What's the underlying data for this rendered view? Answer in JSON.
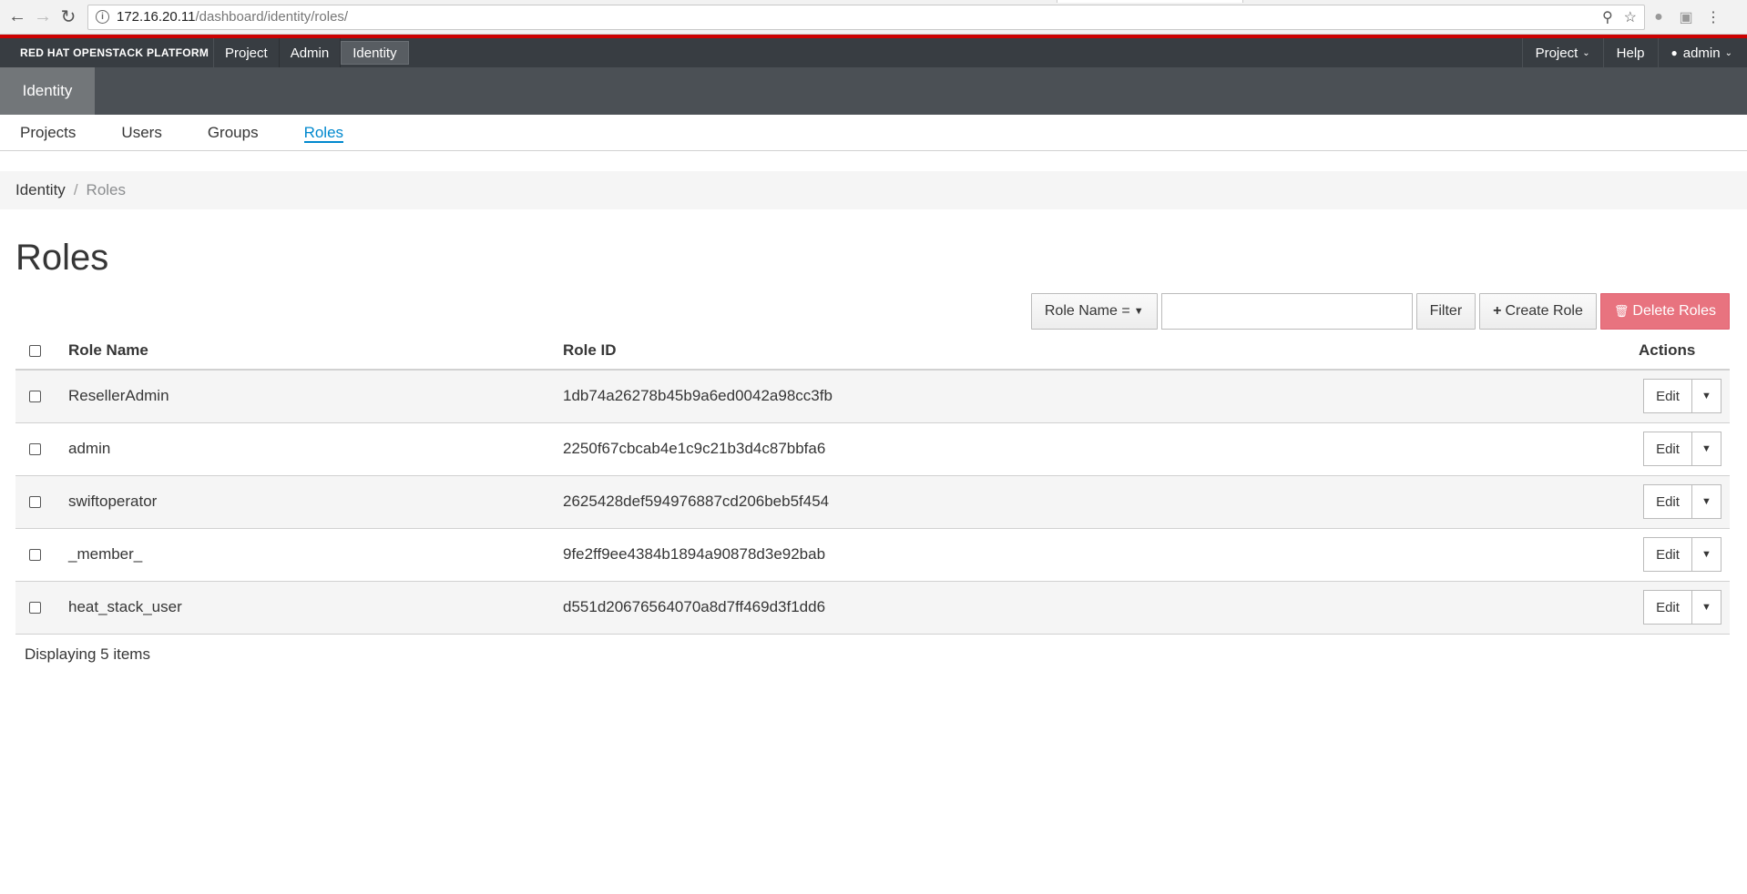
{
  "browser": {
    "url_host": "172.16.20.11",
    "url_path": "/dashboard/identity/roles/"
  },
  "topnav": {
    "brand": "RED HAT OPENSTACK PLATFORM",
    "items": [
      {
        "label": "Project"
      },
      {
        "label": "Admin"
      },
      {
        "label": "Identity"
      }
    ],
    "project_menu": "Project",
    "help": "Help",
    "user": "admin"
  },
  "subheader": {
    "tab": "Identity"
  },
  "subnav": {
    "items": [
      {
        "label": "Projects"
      },
      {
        "label": "Users"
      },
      {
        "label": "Groups"
      },
      {
        "label": "Roles"
      }
    ]
  },
  "breadcrumb": {
    "root": "Identity",
    "sep": "/",
    "current": "Roles"
  },
  "page_title": "Roles",
  "toolbar": {
    "filter_field": "Role Name =",
    "filter_value": "",
    "filter_button": "Filter",
    "create_button": "Create Role",
    "delete_button": "Delete Roles"
  },
  "table": {
    "columns": {
      "name": "Role Name",
      "id": "Role ID",
      "actions": "Actions"
    },
    "rows": [
      {
        "name": "ResellerAdmin",
        "id": "1db74a26278b45b9a6ed0042a98cc3fb",
        "action": "Edit"
      },
      {
        "name": "admin",
        "id": "2250f67cbcab4e1c9c21b3d4c87bbfa6",
        "action": "Edit"
      },
      {
        "name": "swiftoperator",
        "id": "2625428def594976887cd206beb5f454",
        "action": "Edit"
      },
      {
        "name": "_member_",
        "id": "9fe2ff9ee4384b1894a90878d3e92bab",
        "action": "Edit"
      },
      {
        "name": "heat_stack_user",
        "id": "d551d20676564070a8d7ff469d3f1dd6",
        "action": "Edit"
      }
    ],
    "footer": "Displaying 5 items"
  },
  "colors": {
    "brand_red": "#cc0000",
    "active_link": "#0088ce",
    "danger_button": "#e8737f",
    "nav_bg": "#383d42"
  }
}
